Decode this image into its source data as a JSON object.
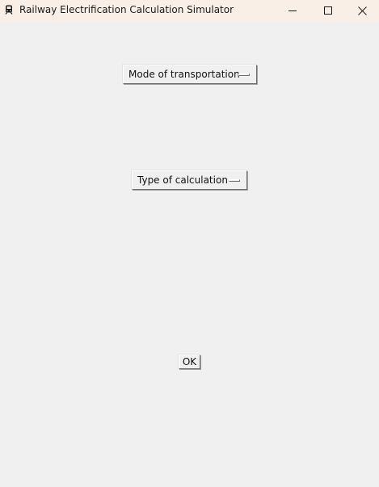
{
  "window": {
    "title": "Railway Electrification Calculation Simulator",
    "icon": "train-icon",
    "controls": {
      "minimize": "minimize-icon",
      "maximize": "maximize-icon",
      "close": "close-icon"
    }
  },
  "form": {
    "mode_menu": {
      "selected": "Mode of transportation"
    },
    "calculation_menu": {
      "selected": "Type of calculation"
    },
    "ok_button": {
      "label": "OK"
    }
  },
  "colors": {
    "titlebar_bg": "#f9efe7",
    "window_bg": "#f0f0f0"
  }
}
